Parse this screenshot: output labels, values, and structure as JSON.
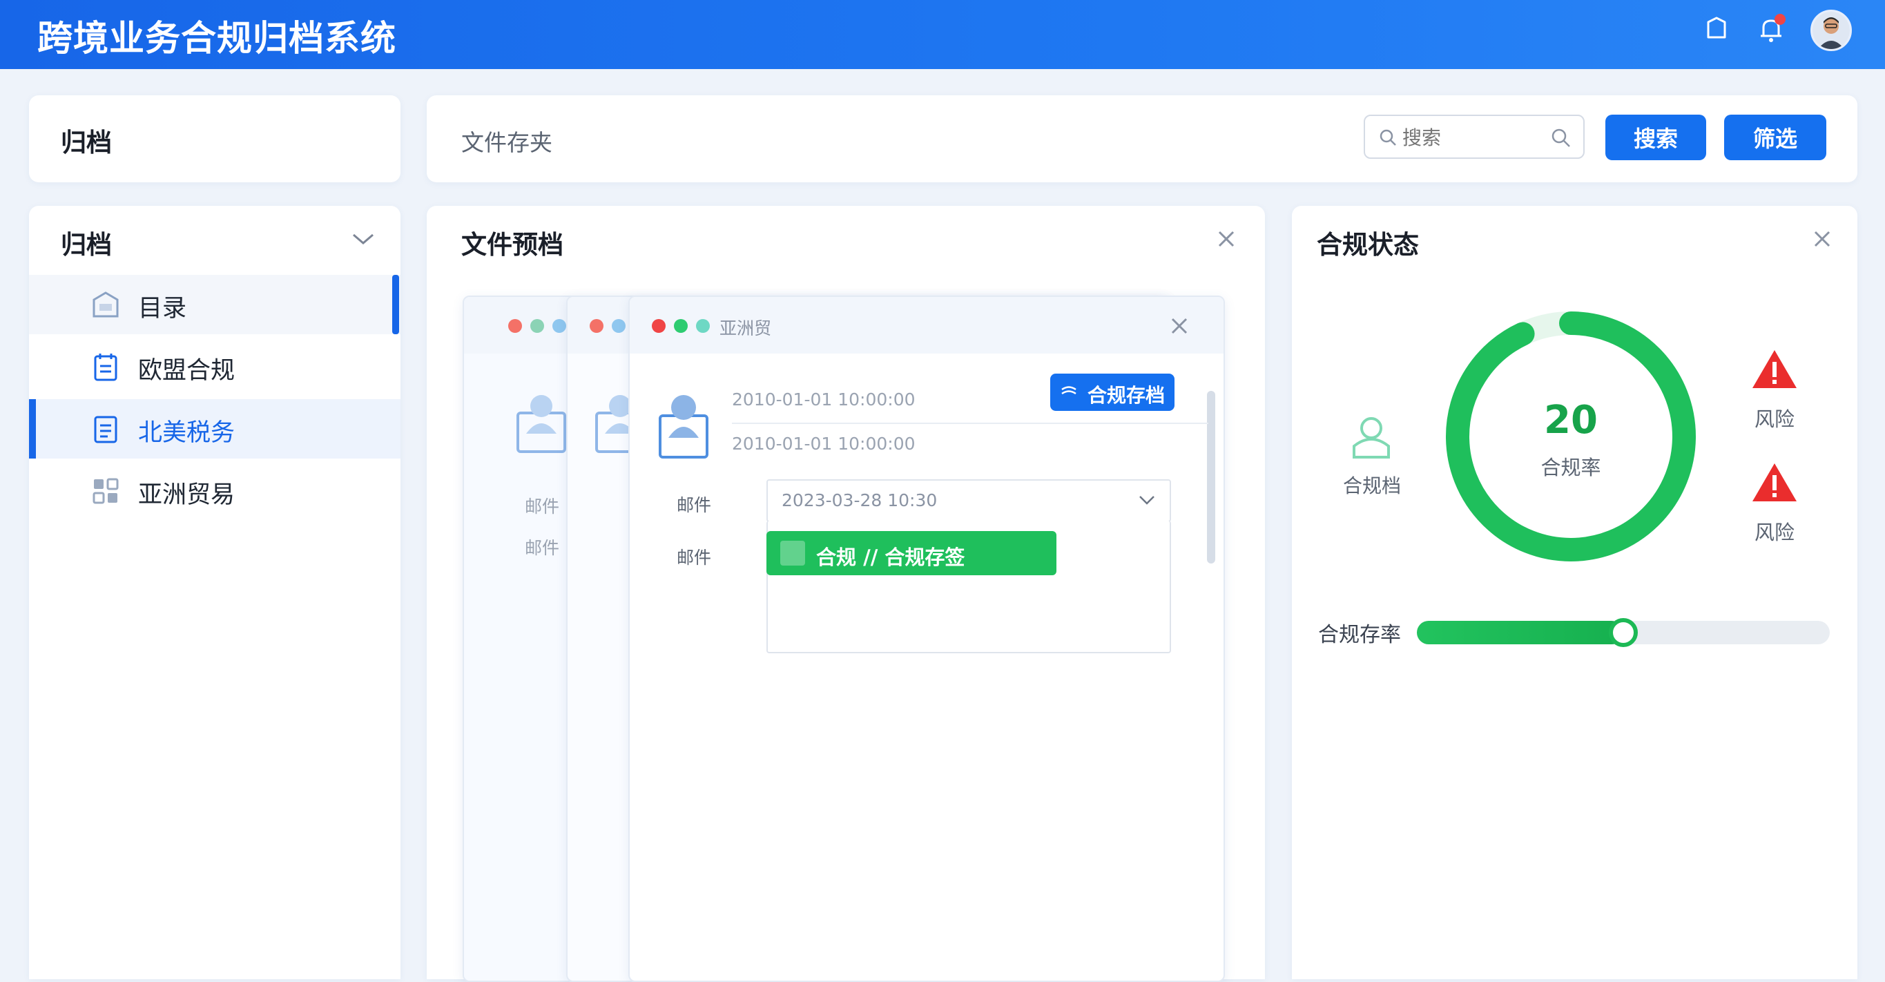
{
  "header": {
    "app_title": "跨境业务合规归档系统",
    "icons": [
      "cube-icon",
      "bell-icon",
      "user-avatar"
    ],
    "colors": {
      "primary": "#1766e8",
      "notification": "#f04545"
    }
  },
  "toolbar": {
    "left_title": "归档",
    "breadcrumb": "文件存夹",
    "search_placeholder": "搜索",
    "search_label": "搜索",
    "filter_label": "筛选"
  },
  "sidebar": {
    "section_title": "归档",
    "items": [
      {
        "label": "目录",
        "icon": "folder-icon",
        "active": false
      },
      {
        "label": "欧盟合规",
        "icon": "clipboard-icon",
        "active": false
      },
      {
        "label": "北美税务",
        "icon": "document-icon",
        "active": true
      },
      {
        "label": "亚洲贸易",
        "icon": "grid-icon",
        "active": false
      }
    ]
  },
  "preview": {
    "title": "文件预档",
    "window_title": "亚洲贸",
    "timestamp_1": "2010-01-01 10:00:00",
    "timestamp_2": "2010-01-01 10:00:00",
    "badge": "合规存档",
    "field_1_label": "邮件",
    "field_1_value": "2023-03-28 10:30",
    "field_2_label": "邮件",
    "action_label": "合规 // 合规存签",
    "back_label_1": "邮件",
    "back_label_2": "邮件"
  },
  "compliance": {
    "title": "合规状态",
    "side_label": "合规档",
    "gauge_value": "20",
    "gauge_label": "合规率",
    "gauge_fraction": 0.93,
    "risk_1": "风险",
    "risk_2": "风险",
    "progress_label": "合规存率",
    "progress_fraction": 0.5,
    "colors": {
      "ok": "#1fbf5c",
      "risk": "#ea2d2d"
    }
  }
}
